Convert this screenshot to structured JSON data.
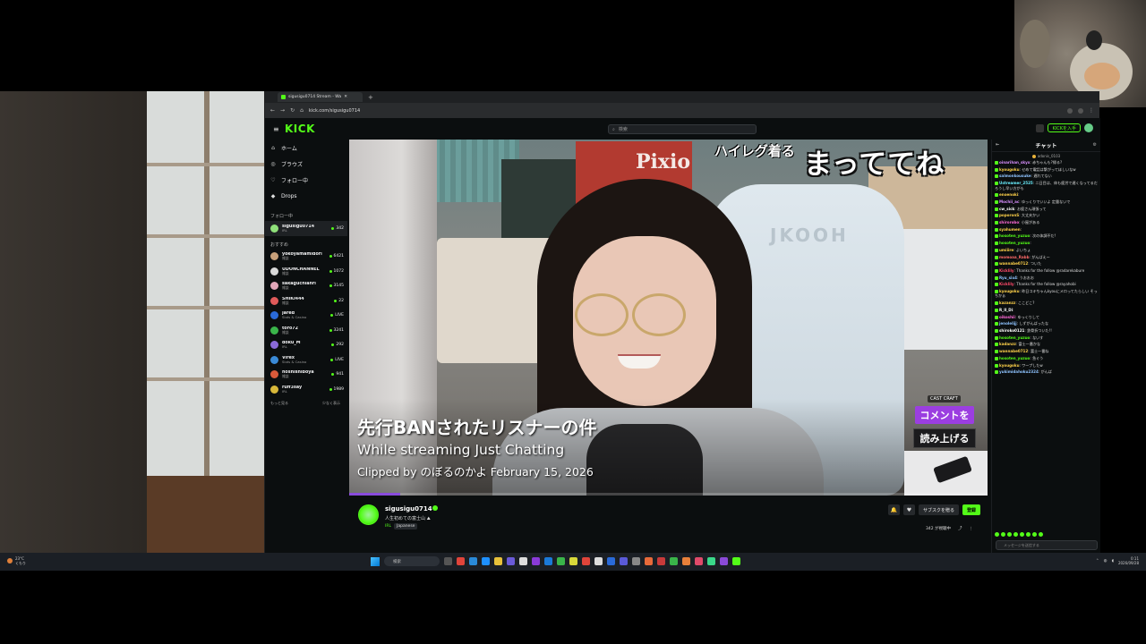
{
  "browser": {
    "tab_title": "sigusigu0714 Stream - Wa",
    "url": "kick.com/sigusigu0714"
  },
  "kick": {
    "logo": "KICK",
    "search_placeholder": "検索",
    "get_kick_label": "KICKを入手"
  },
  "sidebar": {
    "nav": [
      {
        "label": "ホーム",
        "icon": "home-icon"
      },
      {
        "label": "ブラウズ",
        "icon": "compass-icon"
      },
      {
        "label": "フォロー中",
        "icon": "heart-icon"
      },
      {
        "label": "Drops",
        "icon": "drops-icon"
      }
    ],
    "following_heading": "フォロー中",
    "following": [
      {
        "name": "sigusigu0714",
        "category": "IRL",
        "viewers": "342",
        "color": "#8fe07a"
      }
    ],
    "recommended_heading": "おすすめ",
    "recommended": [
      {
        "name": "yokoyamamidori",
        "category": "雑談",
        "viewers": "6421",
        "color": "#c7a07a"
      },
      {
        "name": "UDONCHANNEL",
        "category": "雑談",
        "viewers": "1072",
        "color": "#d9d9d9"
      },
      {
        "name": "sakaguchianri",
        "category": "雑談",
        "viewers": "3145",
        "color": "#e0a6b8"
      },
      {
        "name": "SHIKI444",
        "category": "雑談",
        "viewers": "22",
        "color": "#e05a5a"
      },
      {
        "name": "Jared",
        "category": "Slots & Casino",
        "viewers": "LIVE",
        "color": "#2a6ad8"
      },
      {
        "name": "toro72",
        "category": "雑談",
        "viewers": "3241",
        "color": "#3ab54a"
      },
      {
        "name": "doku_M",
        "category": "IRL",
        "viewers": "292",
        "color": "#8a6ad8"
      },
      {
        "name": "Virex",
        "category": "Slots & Casino",
        "viewers": "LIVE",
        "color": "#3a8ad8"
      },
      {
        "name": "hoshishiboya",
        "category": "雑談",
        "viewers": "941",
        "color": "#d85a3a"
      },
      {
        "name": "ruff3say",
        "category": "IRL",
        "viewers": "1989",
        "color": "#d8b83a"
      }
    ],
    "show_more": "もっと見る",
    "show_less": "少なく表示"
  },
  "player": {
    "overlay_small": "ハイレグ着る",
    "overlay_big": "まっててね",
    "box_text": "Pixio",
    "chair_text": "JKOOH",
    "cast_label": "CAST CRAFT",
    "comment_button": "コメントを",
    "read_button": "読み上げる",
    "caption_title": "先行BANされたリスナーの件",
    "caption_line1": "While streaming Just Chatting",
    "caption_line2": "Clipped by のぼるのかよ February 15, 2026",
    "progress": 0.08
  },
  "streamer": {
    "name": "sigusigu0714",
    "title": "人生初めての富士山 ⛰",
    "category": "IRL",
    "language": "Japanese",
    "subscribe_label": "サブスクを贈る",
    "follow_label": "登録",
    "viewers_label": "342 が視聴中"
  },
  "chat": {
    "title": "チャット",
    "pinned_user": "adonis_0103",
    "messages": [
      {
        "user": "oinarihan_skyx",
        "color": "#d98fff",
        "text": "赤ちゃんも?帰る?"
      },
      {
        "user": "kyougoku",
        "color": "#ffd24a",
        "text": "せめて電話は繋がってほしいなw"
      },
      {
        "user": "salmonkousuke",
        "color": "#8fc3ff",
        "text": "遅れてない"
      },
      {
        "user": "Ustreamer_2525",
        "color": "#6af0ff",
        "text": "二日目は、休も疲労で遅くなってるだろうし早い方がも"
      },
      {
        "user": "enoenoki",
        "color": "#ffd24a",
        "text": ""
      },
      {
        "user": "Mochii_ac",
        "color": "#d98fff",
        "text": "ゆっくりでいいよ 定量ないで"
      },
      {
        "user": "cw_sick",
        "color": "#ffffff",
        "text": "お疲さん頑張って"
      },
      {
        "user": "poporonS",
        "color": "#ffd24a",
        "text": "大丈夫かい"
      },
      {
        "user": "shirorobo",
        "color": "#ff6ad8",
        "text": "小屋がある"
      },
      {
        "user": "syahumen",
        "color": "#ffd24a",
        "text": ""
      },
      {
        "user": "hosoten_yuzuo",
        "color": "#53fc18",
        "text": "次の体調不だ!"
      },
      {
        "user": "hosoten_yuzuo",
        "color": "#53fc18",
        "text": ""
      },
      {
        "user": "umiiire",
        "color": "#ffd24a",
        "text": "よいちょ"
      },
      {
        "user": "momoaa_Rabb",
        "color": "#ff6a6a",
        "text": "がんばえー"
      },
      {
        "user": "wannabe0712",
        "color": "#ffd24a",
        "text": "ついた"
      },
      {
        "user": "Kicklily",
        "color": "#ff4a6a",
        "text": "Thanks for the follow @radarekabure"
      },
      {
        "user": "Ryu_six4",
        "color": "#8fc3ff",
        "text": "うおおお"
      },
      {
        "user": "Kicklily",
        "color": "#ff4a6a",
        "text": "Thanks for the follow @rayahobi"
      },
      {
        "user": "kyougoku",
        "color": "#ffd24a",
        "text": "昨日コキちゃんkyouにメロってたらしい そっちかぁ"
      },
      {
        "user": "kazanzz",
        "color": "#ffd24a",
        "text": "ここどこ?"
      },
      {
        "user": "R_II_Di",
        "color": "#ffffff",
        "text": ""
      },
      {
        "user": "oikoshii",
        "color": "#ff6ad8",
        "text": "ゆっくりして"
      },
      {
        "user": "jenolelijj",
        "color": "#8fc3ff",
        "text": "しずがんばったな"
      },
      {
        "user": "shiroko0121",
        "color": "#ffffff",
        "text": "鉄骨折ついた!!"
      },
      {
        "user": "hosoten_yuzuo",
        "color": "#53fc18",
        "text": "ないす"
      },
      {
        "user": "kadanzz",
        "color": "#ffd24a",
        "text": "富士一番かな"
      },
      {
        "user": "wannabe0712",
        "color": "#ffd24a",
        "text": "富士一番ね"
      },
      {
        "user": "hosoten_yuzuo",
        "color": "#53fc18",
        "text": "急ぐう"
      },
      {
        "user": "kyougoku",
        "color": "#ffd24a",
        "text": "ワープしたw"
      },
      {
        "user": "yukimidahoku2324",
        "color": "#8fc3ff",
        "text": "がんば"
      }
    ],
    "input_placeholder": "メッセージを送信する"
  },
  "taskbar": {
    "weather_temp": "23°C",
    "weather_text": "くもり",
    "search_label": "検索",
    "time": "0:11",
    "date": "2026/09/28"
  }
}
